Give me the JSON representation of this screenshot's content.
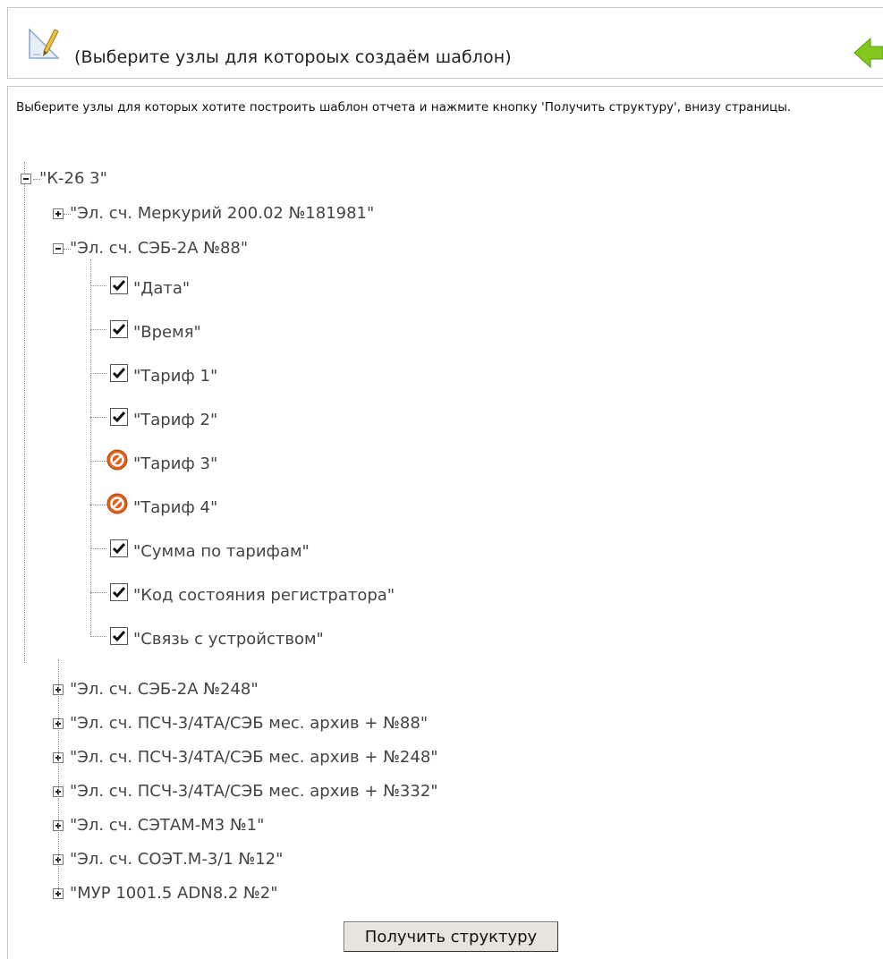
{
  "header": {
    "title": "(Выберите узлы для котороых создаём шаблон)",
    "icon": "pencil-ruler-icon",
    "back_icon": "green-left-arrow-icon"
  },
  "instructions": "Выберите узлы для которых хотите построить шаблон отчета и нажмите кнопку 'Получить структуру', внизу страницы.",
  "tree": {
    "root": {
      "label": "\"К-26 3\"",
      "expanded": true
    },
    "meter_mercury": {
      "label": "\"Эл. сч. Меркурий 200.02 №181981\"",
      "expanded": false
    },
    "meter_seb88": {
      "label": "\"Эл. сч. СЭБ-2А №88\"",
      "expanded": true,
      "children": [
        {
          "label": "\"Дата\"",
          "state": "checked"
        },
        {
          "label": "\"Время\"",
          "state": "checked"
        },
        {
          "label": "\"Тариф 1\"",
          "state": "checked"
        },
        {
          "label": "\"Тариф 2\"",
          "state": "checked"
        },
        {
          "label": "\"Тариф 3\"",
          "state": "disabled"
        },
        {
          "label": "\"Тариф 4\"",
          "state": "disabled"
        },
        {
          "label": "\"Сумма по тарифам\"",
          "state": "checked"
        },
        {
          "label": "\"Код состояния регистратора\"",
          "state": "checked"
        },
        {
          "label": "\"Связь с устройством\"",
          "state": "checked"
        }
      ]
    },
    "collapsed_nodes": [
      {
        "label": "\"Эл. сч. СЭБ-2А №248\"",
        "expanded": false
      },
      {
        "label": "\"Эл. сч. ПСЧ-3/4ТА/СЭБ мес. архив + №88\"",
        "expanded": false
      },
      {
        "label": "\"Эл. сч. ПСЧ-3/4ТА/СЭБ мес. архив + №248\"",
        "expanded": false
      },
      {
        "label": "\"Эл. сч. ПСЧ-3/4ТА/СЭБ мес. архив + №332\"",
        "expanded": false
      },
      {
        "label": "\"Эл. сч. СЭТАМ-М3 №1\"",
        "expanded": false
      },
      {
        "label": "\"Эл. сч. СОЭТ.М-3/1 №12\"",
        "expanded": false
      },
      {
        "label": "\"МУР 1001.5 ADN8.2 №2\"",
        "expanded": false
      }
    ]
  },
  "submit_label": "Получить структуру",
  "colors": {
    "border": "#c8c8c8",
    "check_mark": "#111111",
    "ban_icon": "#e0601a",
    "back_arrow": "#7fc400"
  }
}
